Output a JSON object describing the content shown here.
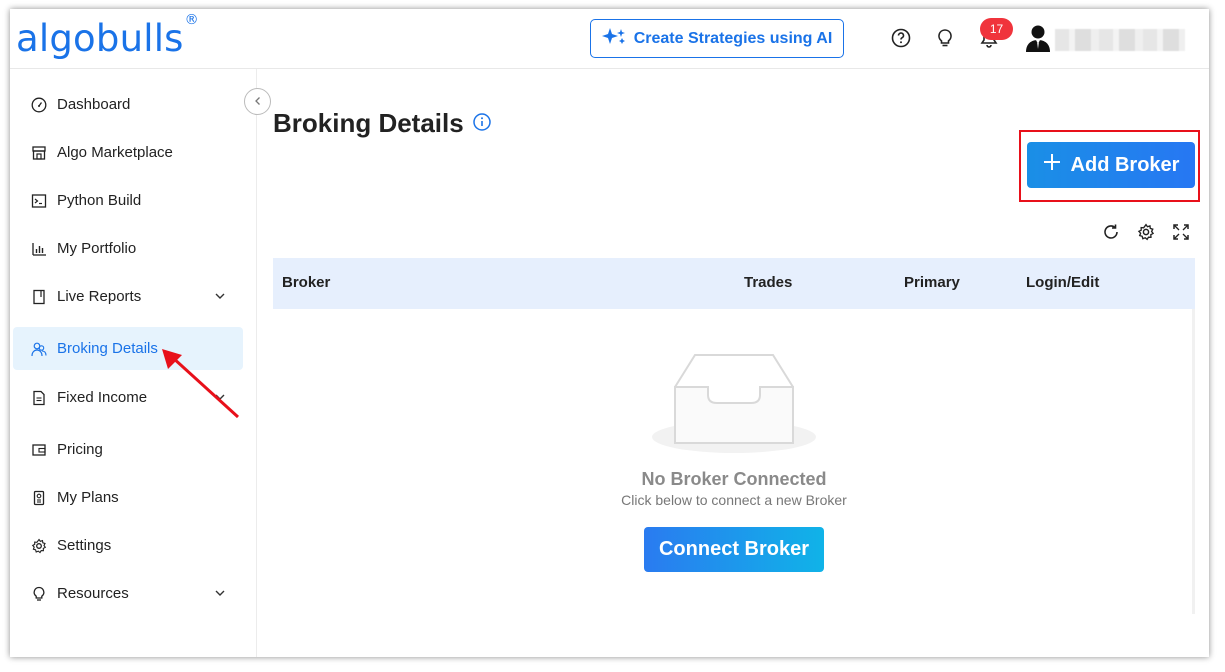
{
  "header": {
    "logo": "algobulls",
    "logo_mark": "®",
    "ai_button": "Create Strategies using AI",
    "notification_count": "17",
    "icons": [
      "help-icon",
      "lightbulb-icon",
      "bell-icon",
      "user-avatar-icon"
    ]
  },
  "sidebar": {
    "items": [
      {
        "label": "Dashboard",
        "icon": "dashboard-gauge-icon",
        "has_chevron": false
      },
      {
        "label": "Algo Marketplace",
        "icon": "store-icon",
        "has_chevron": false
      },
      {
        "label": "Python Build",
        "icon": "terminal-icon",
        "has_chevron": false
      },
      {
        "label": "My Portfolio",
        "icon": "bar-chart-icon",
        "has_chevron": false
      },
      {
        "label": "Live Reports",
        "icon": "report-icon",
        "has_chevron": true
      },
      {
        "label": "Broking Details",
        "icon": "users-icon",
        "has_chevron": false,
        "active": true
      },
      {
        "label": "Fixed Income",
        "icon": "document-icon",
        "has_chevron": true
      },
      {
        "label": "Pricing",
        "icon": "wallet-icon",
        "has_chevron": false
      },
      {
        "label": "My Plans",
        "icon": "plan-icon",
        "has_chevron": false
      },
      {
        "label": "Settings",
        "icon": "gear-icon",
        "has_chevron": false
      },
      {
        "label": "Resources",
        "icon": "lightbulb-icon",
        "has_chevron": true
      }
    ]
  },
  "main": {
    "title": "Broking Details",
    "add_broker": "Add Broker",
    "table_headers": [
      "Broker",
      "Trades",
      "Primary",
      "Login/Edit"
    ],
    "empty_title": "No Broker Connected",
    "empty_subtitle": "Click below to connect a new Broker",
    "connect_button": "Connect Broker"
  },
  "colors": {
    "brand": "#1a73e8",
    "active_bg": "#e6f3fd",
    "highlight": "#e8101a",
    "badge": "#f0343c"
  }
}
